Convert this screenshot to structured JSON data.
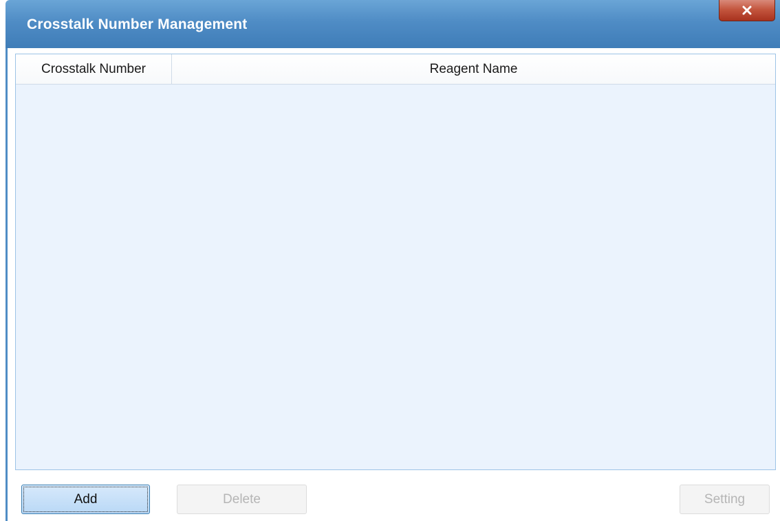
{
  "window": {
    "title": "Crosstalk Number Management",
    "close_label": "x"
  },
  "table": {
    "columns": [
      {
        "label": "Crosstalk Number"
      },
      {
        "label": "Reagent Name"
      }
    ],
    "rows": []
  },
  "buttons": {
    "add": {
      "label": "Add",
      "enabled": true
    },
    "delete": {
      "label": "Delete",
      "enabled": false
    },
    "setting": {
      "label": "Setting",
      "enabled": false
    }
  },
  "colors": {
    "titlebar": "#4f8cc5",
    "close": "#c4563f",
    "grid_background": "#ebf3fd"
  },
  "icons": {
    "close": "close-icon"
  }
}
